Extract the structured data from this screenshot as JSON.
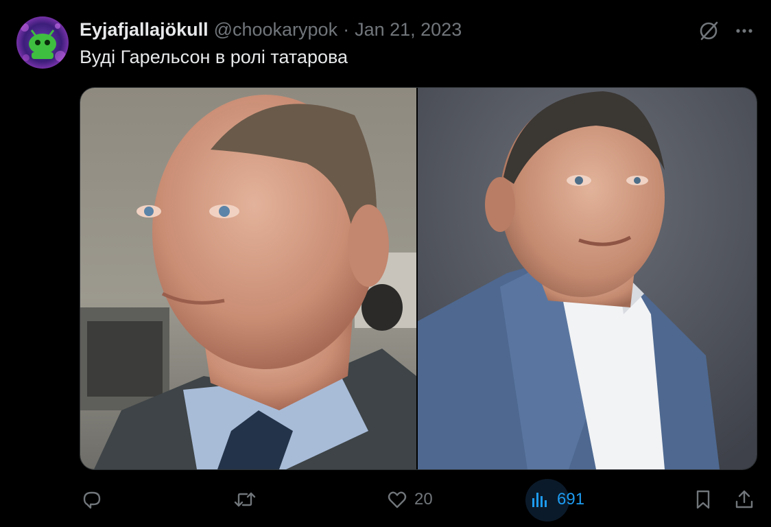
{
  "author": {
    "display_name": "Eyjafjallajökull",
    "handle": "@chookarypok",
    "separator": "·",
    "date": "Jan 21, 2023",
    "avatar_icon": "green-alien-avatar-icon"
  },
  "tweet": {
    "text": "Вуді Гарельсон в ролі татарова"
  },
  "media": {
    "left_photo": "portrait-photo-man-blue-shirt-dark-jacket",
    "right_photo": "portrait-photo-man-blue-suit-white-shirt"
  },
  "actions": {
    "reply_icon": "reply-icon",
    "retweet_icon": "retweet-icon",
    "like_icon": "heart-icon",
    "like_count": "20",
    "views_icon": "views-bar-chart-icon",
    "views_count": "691",
    "bookmark_icon": "bookmark-icon",
    "share_icon": "share-icon"
  },
  "top_icons": {
    "grok": "grok-slash-circle-icon",
    "more": "more-dots-icon"
  },
  "colors": {
    "background": "#000000",
    "text_primary": "#e7e9ea",
    "text_secondary": "#71767b",
    "accent": "#1d9bf0"
  }
}
